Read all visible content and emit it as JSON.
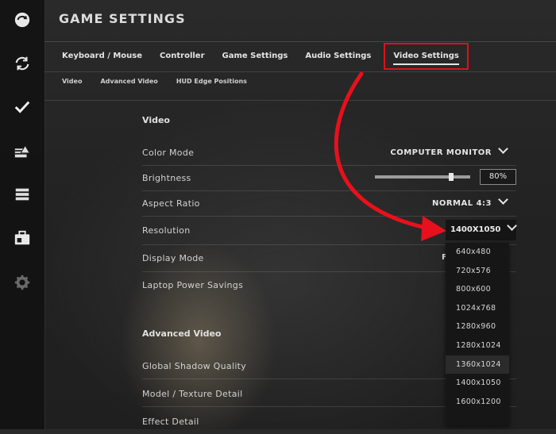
{
  "sidebar": {
    "icons": [
      "back-icon",
      "refresh-icon",
      "check-icon",
      "warning-folder-icon",
      "list-icon",
      "briefcase-icon",
      "gear-icon"
    ]
  },
  "header": {
    "title": "GAME SETTINGS"
  },
  "tabs": [
    {
      "label": "Keyboard / Mouse"
    },
    {
      "label": "Controller"
    },
    {
      "label": "Game Settings"
    },
    {
      "label": "Audio Settings"
    },
    {
      "label": "Video Settings",
      "active": true
    }
  ],
  "subtabs": [
    {
      "label": "Video"
    },
    {
      "label": "Advanced Video"
    },
    {
      "label": "HUD Edge Positions"
    }
  ],
  "video": {
    "heading": "Video",
    "color_mode": {
      "label": "Color Mode",
      "value": "COMPUTER MONITOR"
    },
    "brightness": {
      "label": "Brightness",
      "value": "80%",
      "level": 0.8
    },
    "aspect_ratio": {
      "label": "Aspect Ratio",
      "value": "NORMAL 4:3"
    },
    "resolution": {
      "label": "Resolution",
      "value": "1400X1050"
    },
    "display_mode": {
      "label": "Display Mode",
      "value_peek": "F"
    },
    "laptop_power": {
      "label": "Laptop Power Savings"
    }
  },
  "resolution_options": [
    "640x480",
    "720x576",
    "800x600",
    "1024x768",
    "1280x960",
    "1280x1024",
    "1360x1024",
    "1400x1050",
    "1600x1200"
  ],
  "advanced": {
    "heading": "Advanced Video",
    "shadow": {
      "label": "Global Shadow Quality"
    },
    "texture": {
      "label": "Model / Texture Detail"
    },
    "effect": {
      "label": "Effect Detail"
    }
  },
  "colors": {
    "highlight": "#e0101a",
    "arrow": "#e8101c"
  }
}
